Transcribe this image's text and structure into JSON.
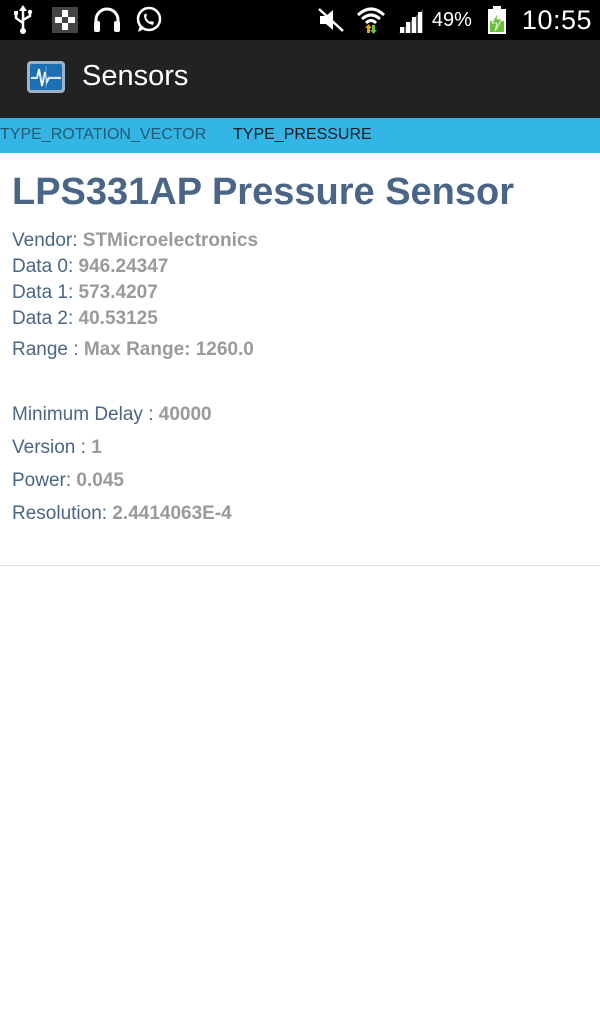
{
  "status_bar": {
    "icons_left": [
      "usb-icon",
      "notification-icon",
      "headset-icon",
      "whatsapp-icon"
    ],
    "icons_right": [
      "mute-icon",
      "wifi-icon",
      "signal-icon",
      "battery-icon"
    ],
    "battery_percent": "49%",
    "time": "10:55"
  },
  "action_bar": {
    "title": "Sensors",
    "icon": "sensor-app-icon"
  },
  "tabs": [
    {
      "label": "TYPE_ROTATION_VECTOR",
      "active": false
    },
    {
      "label": "TYPE_PRESSURE",
      "active": true
    }
  ],
  "sensor": {
    "name": "LPS331AP Pressure Sensor",
    "vendor_label": "Vendor: ",
    "vendor_value": "STMicroelectronics",
    "data0_label": "Data 0: ",
    "data0_value": "946.24347",
    "data1_label": "Data 1: ",
    "data1_value": "573.4207",
    "data2_label": "Data 2: ",
    "data2_value": "40.53125",
    "range_label": "Range :  ",
    "range_value": "Max Range: 1260.0",
    "min_delay_label": "Minimum Delay :  ",
    "min_delay_value": "40000",
    "version_label": "Version :  ",
    "version_value": "1",
    "power_label": "Power:  ",
    "power_value": "0.045",
    "resolution_label": "Resolution:  ",
    "resolution_value": "2.4414063E-4"
  },
  "colors": {
    "tab_strip": "#33b5e5",
    "heading": "#4a6585",
    "value": "#9a9a9a",
    "action_bar": "#222222"
  }
}
